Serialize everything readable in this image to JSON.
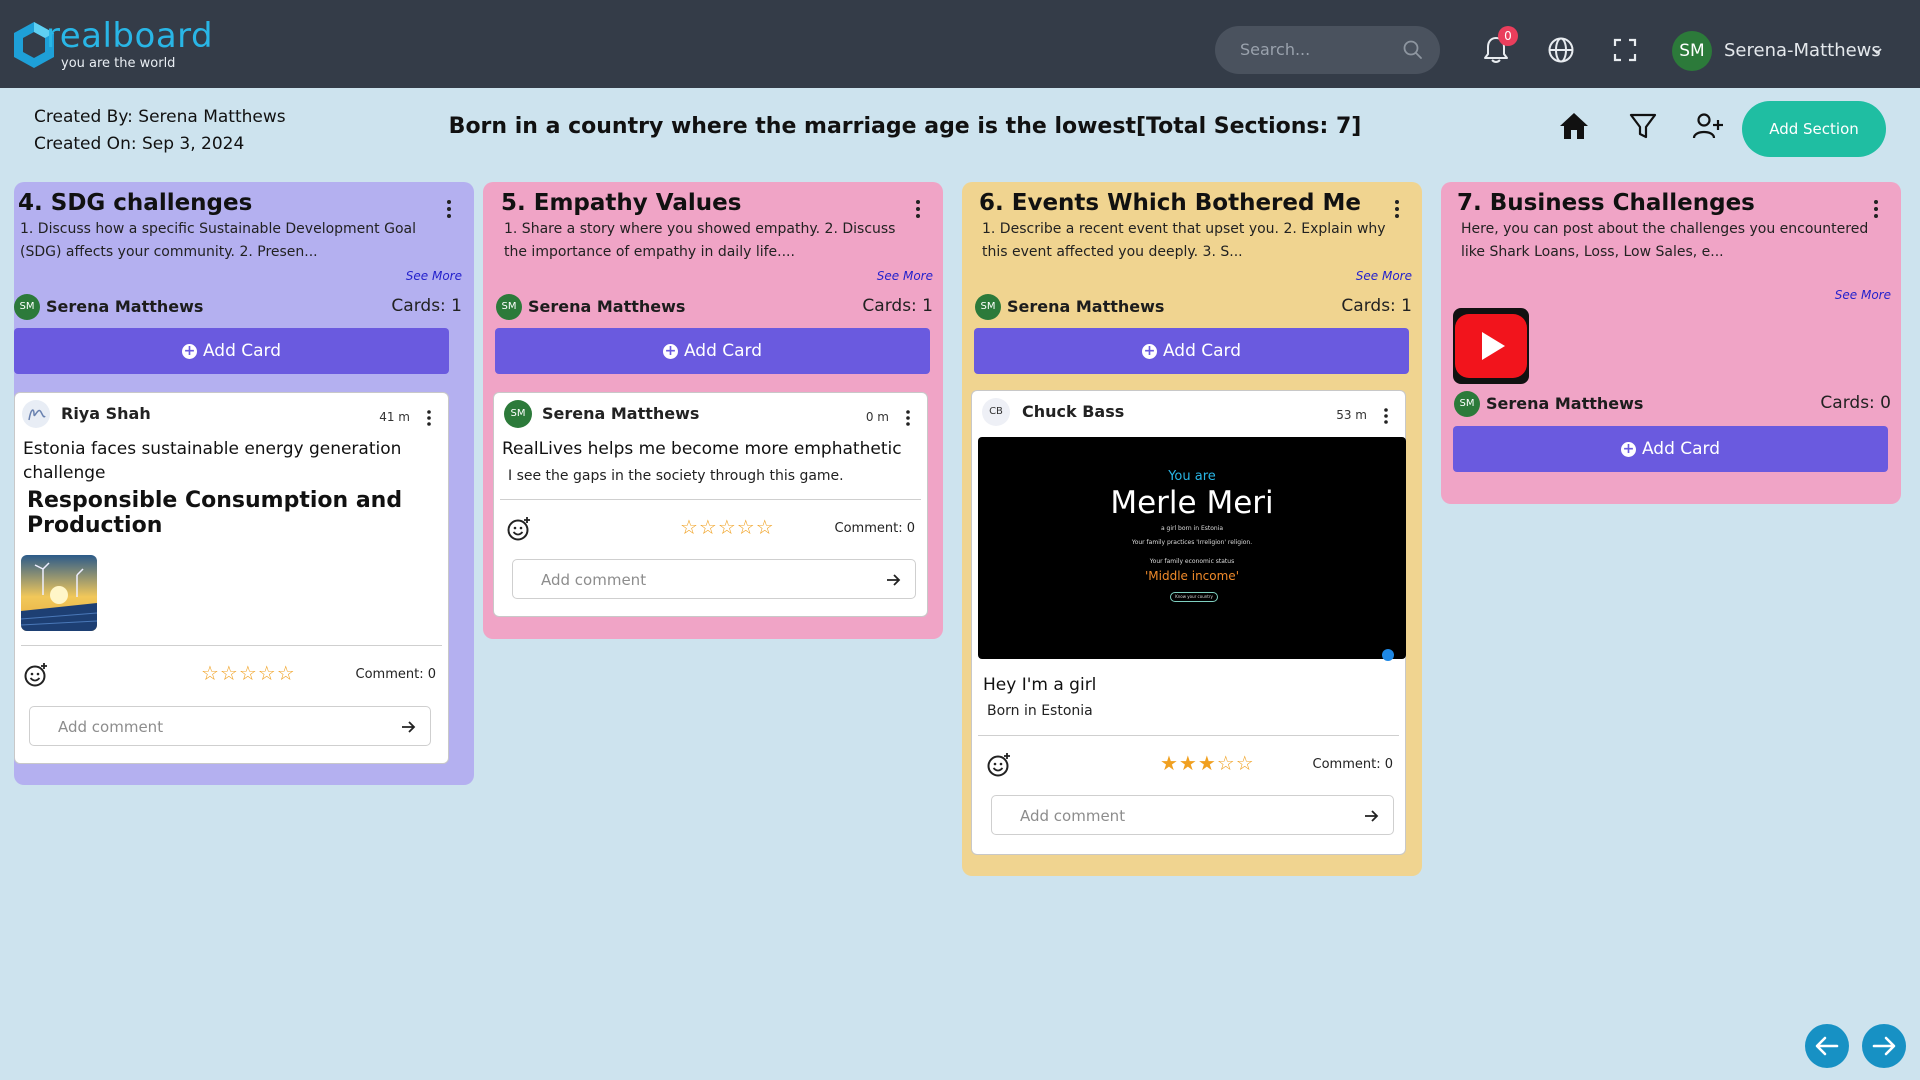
{
  "app": {
    "logo_word": "realboard",
    "logo_tagline": "you are the world",
    "search_placeholder": "Search...",
    "notification_count": "0",
    "user_initials": "SM",
    "user_name": "Serena-Matthews"
  },
  "board": {
    "created_by": "Created By: Serena Matthews",
    "created_on": "Created On: Sep 3, 2024",
    "title": "Born in a country where the marriage age is the lowest[Total Sections: 7]",
    "add_section_label": "Add Section"
  },
  "columns": [
    {
      "title": "4. SDG challenges",
      "description": "1. Discuss how a specific Sustainable Development Goal (SDG) affects your community. 2. Presen...",
      "see_more": "See More",
      "owner_initials": "SM",
      "owner": "Serena Matthews",
      "cards_count": "Cards: 1",
      "add_card": "Add Card",
      "bg": "#b4b0f0",
      "card": {
        "author": "Riya Shah",
        "time": "41 m",
        "title": "Estonia faces sustainable energy generation challenge",
        "heading": "Responsible Consumption and Production",
        "rating": "☆☆☆☆☆",
        "comment_count": "Comment: 0",
        "comment_placeholder": "Add comment"
      }
    },
    {
      "title": "5. Empathy Values",
      "description": "1. Share a story where you showed empathy. 2. Discuss the importance of empathy in daily life....",
      "see_more": "See More",
      "owner_initials": "SM",
      "owner": "Serena Matthews",
      "cards_count": "Cards: 1",
      "add_card": "Add Card",
      "bg": "#f0a4c6",
      "card": {
        "author_initials": "SM",
        "author": "Serena Matthews",
        "time": "0 m",
        "title": "RealLives helps me become more emphathetic",
        "subtitle": "I see the gaps in the society through this game.",
        "rating": "☆☆☆☆☆",
        "comment_count": "Comment: 0",
        "comment_placeholder": "Add comment"
      }
    },
    {
      "title": "6. Events Which Bothered Me",
      "description": "1. Describe a recent event that upset you. 2. Explain why this event affected you deeply. 3. S...",
      "see_more": "See More",
      "owner_initials": "SM",
      "owner": "Serena Matthews",
      "cards_count": "Cards: 1",
      "add_card": "Add Card",
      "bg": "#f0d490",
      "card": {
        "author_initials": "CB",
        "author": "Chuck Bass",
        "time": "53 m",
        "image": {
          "you_are": "You are",
          "name": "Merle Meri",
          "line1": "a girl born in Estonia",
          "line2": "Your family practices 'Irreligion' religion.",
          "line3": "Your family economic status",
          "status": "'Middle income'",
          "button": "Know your country"
        },
        "title": "Hey I'm a girl",
        "subtitle": "Born in Estonia",
        "rating_filled": "★★★",
        "rating_empty": "☆☆",
        "comment_count": "Comment: 0",
        "comment_placeholder": "Add comment"
      }
    },
    {
      "title": "7. Business Challenges",
      "description": "Here, you can post about the challenges you encountered like Shark Loans, Loss, Low Sales, e...",
      "see_more": "See More",
      "owner_initials": "SM",
      "owner": "Serena Matthews",
      "cards_count": "Cards: 0",
      "add_card": "Add Card",
      "bg": "#f0a4c6"
    }
  ],
  "colors": {
    "nav_bg": "#343c48",
    "page_bg": "#cde3ee",
    "accent_teal": "#1fbea2",
    "add_card_purple": "#6a5adf",
    "star_orange": "#f0a020"
  }
}
